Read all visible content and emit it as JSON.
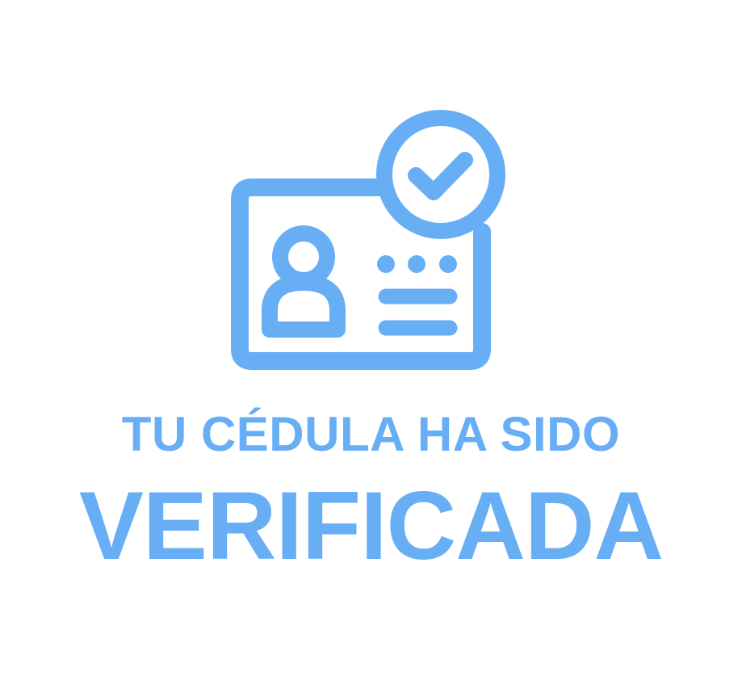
{
  "colors": {
    "accent": "#67aef5",
    "background": "#ffffff"
  },
  "icons": {
    "card": "id-card-icon",
    "badge": "check-badge-icon",
    "avatar": "person-icon"
  },
  "message": {
    "line1": "TU CÉDULA HA SIDO",
    "line2": "VERIFICADA"
  }
}
